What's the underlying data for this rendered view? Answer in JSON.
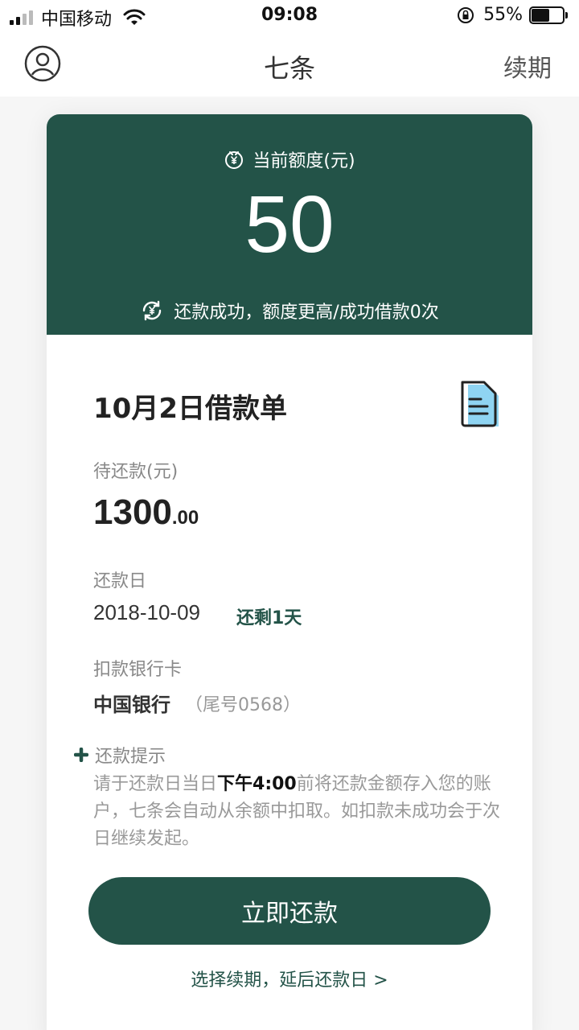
{
  "status_bar": {
    "carrier": "中国移动",
    "time": "09:08",
    "battery_percent": "55%",
    "battery_level": 0.55,
    "signal_bars": 2
  },
  "nav": {
    "title": "七条",
    "right_link": "续期",
    "left_icon": "user-avatar-icon"
  },
  "quota": {
    "label": "当前额度(元)",
    "value": "50",
    "tip": "还款成功，额度更高/成功借款0次"
  },
  "loan": {
    "title": "10月2日借款单",
    "pending_label": "待还款(元)",
    "pending_int": "1300",
    "pending_dec": ".00",
    "due_label": "还款日",
    "due_date": "2018-10-09",
    "days_left": "还剩1天",
    "bank_label": "扣款银行卡",
    "bank_name": "中国银行",
    "bank_tail": "（尾号0568）"
  },
  "tip": {
    "heading": "还款提示",
    "body_pre": "请于还款日当日",
    "body_bold": "下午4:00",
    "body_post": "前将还款金额存入您的账户，七条会自动从余额中扣取。如扣款未成功会于次日继续发起。"
  },
  "actions": {
    "repay_button": "立即还款",
    "extend_link": "选择续期，延后还款日 >"
  },
  "colors": {
    "brand": "#235348",
    "doc_icon_fill": "#8fd4f2"
  }
}
